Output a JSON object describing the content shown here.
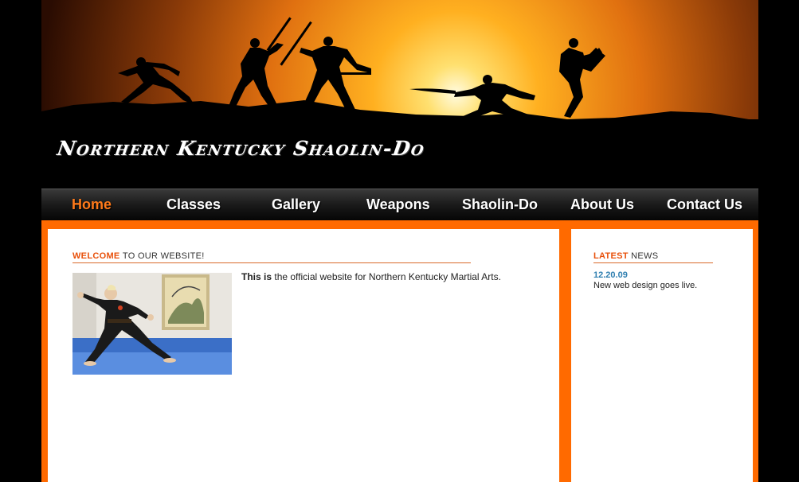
{
  "header": {
    "site_title": "Northern Kentucky Shaolin-Do"
  },
  "nav": {
    "items": [
      {
        "label": "Home",
        "active": true
      },
      {
        "label": "Classes",
        "active": false
      },
      {
        "label": "Gallery",
        "active": false
      },
      {
        "label": "Weapons",
        "active": false
      },
      {
        "label": "Shaolin-Do",
        "active": false
      },
      {
        "label": "About Us",
        "active": false
      },
      {
        "label": "Contact Us",
        "active": false
      }
    ]
  },
  "main": {
    "heading_highlight": "WELCOME",
    "heading_rest": "TO OUR WEBSITE!",
    "intro_lead": "This is",
    "intro_text": "the official website for Northern Kentucky Martial Arts."
  },
  "sidebar": {
    "heading_highlight": "LATEST",
    "heading_rest": "NEWS",
    "news": [
      {
        "date": "12.20.09",
        "text": "New web design goes live."
      }
    ]
  },
  "colors": {
    "accent": "#ff6a00",
    "nav_active": "#ff7a1a",
    "news_date": "#2f7fb0",
    "background": "#000000"
  }
}
